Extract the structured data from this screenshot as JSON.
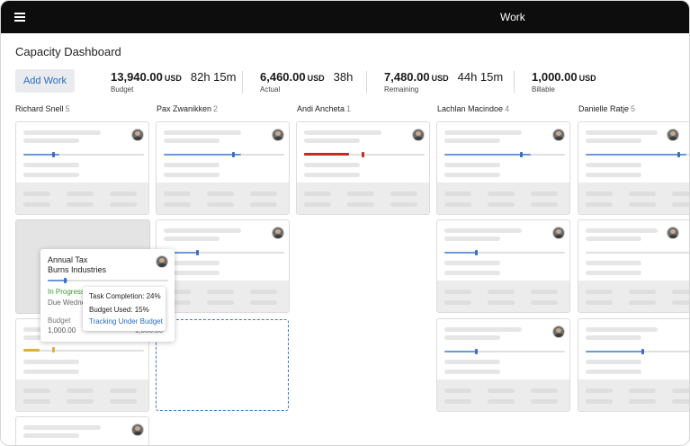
{
  "app": {
    "title": "Work"
  },
  "page": {
    "title": "Capacity Dashboard"
  },
  "toolbar": {
    "add_label": "Add Work"
  },
  "stats": [
    {
      "amount": "13,940.00",
      "currency": "USD",
      "hours": "82h 15m",
      "label": "Budget"
    },
    {
      "amount": "6,460.00",
      "currency": "USD",
      "hours": "38h",
      "label": "Actual"
    },
    {
      "amount": "7,480.00",
      "currency": "USD",
      "hours": "44h 15m",
      "label": "Remaining"
    },
    {
      "amount": "1,000.00",
      "currency": "USD",
      "hours": "",
      "label": "Billable"
    }
  ],
  "columns": [
    {
      "name": "Richard Snell",
      "count": "5"
    },
    {
      "name": "Pax Zwanikken",
      "count": "2"
    },
    {
      "name": "Andi Ancheta",
      "count": "1"
    },
    {
      "name": "Lachlan Macindoe",
      "count": "4"
    },
    {
      "name": "Danielle Ratje",
      "count": "5"
    }
  ],
  "popup": {
    "title_line1": "Annual Tax",
    "title_line2": "Burns Industries",
    "status": "In Progress",
    "due": "Due Wedne",
    "budget_label": "Budget",
    "budget_value": "1,000.00",
    "partial_value": "1,000.00",
    "progress": 0.4
  },
  "tooltip": {
    "task_completion": "Task Completion: 24%",
    "budget_used": "Budget Used: 15%",
    "tracking": "Tracking Under Budget"
  },
  "colors": {
    "accent": "#2a6cc0",
    "progress": "#6d97d8",
    "over_budget": "#c42b22",
    "warning": "#e0b030",
    "in_progress": "#3c9b2f"
  }
}
